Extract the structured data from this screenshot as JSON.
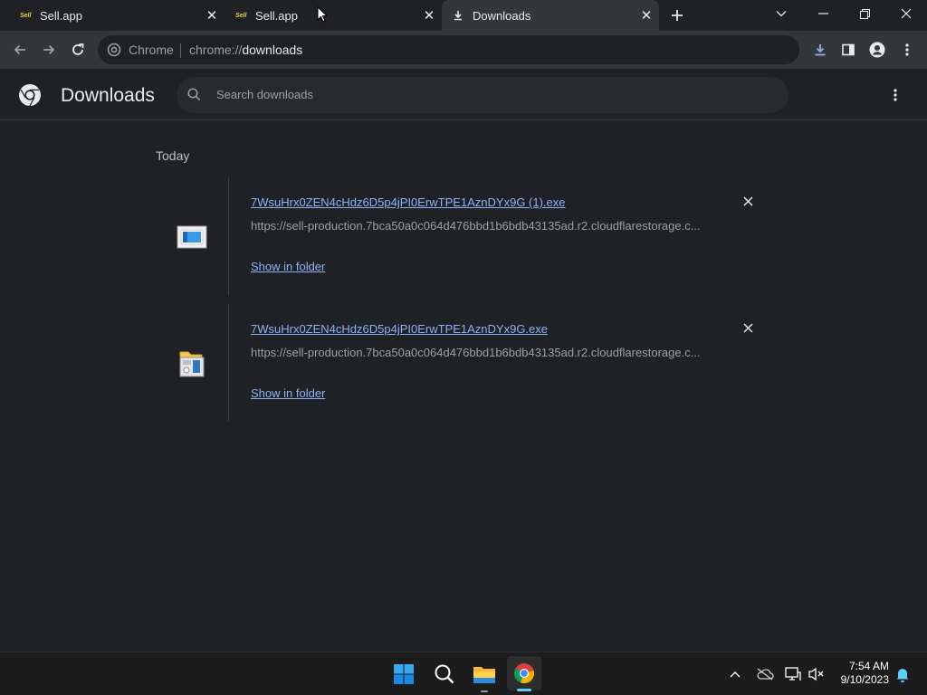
{
  "tabs": [
    {
      "title": "Sell.app",
      "favicon_text": "Sell"
    },
    {
      "title": "Sell.app",
      "favicon_text": "Sell"
    },
    {
      "title": "Downloads"
    }
  ],
  "toolbar": {
    "site_chip": "Chrome",
    "url_scheme": "chrome://",
    "url_path": "downloads"
  },
  "downloads_page": {
    "title": "Downloads",
    "search_placeholder": "Search downloads",
    "section_label": "Today",
    "items": [
      {
        "filename": "7WsuHrx0ZEN4cHdz6D5p4jPI0ErwTPE1AznDYx9G (1).exe",
        "url": "https://sell-production.7bca50a0c064d476bbd1b6bdb43135ad.r2.cloudflarestorage.c...",
        "action": "Show in folder",
        "icon": "installer-icon"
      },
      {
        "filename": "7WsuHrx0ZEN4cHdz6D5p4jPI0ErwTPE1AznDYx9G.exe",
        "url": "https://sell-production.7bca50a0c064d476bbd1b6bdb43135ad.r2.cloudflarestorage.c...",
        "action": "Show in folder",
        "icon": "setup-icon"
      }
    ]
  },
  "taskbar": {
    "time": "7:54 AM",
    "date": "9/10/2023"
  },
  "colors": {
    "link": "#8ab4f8",
    "background": "#202124",
    "toolbar": "#35363a"
  }
}
